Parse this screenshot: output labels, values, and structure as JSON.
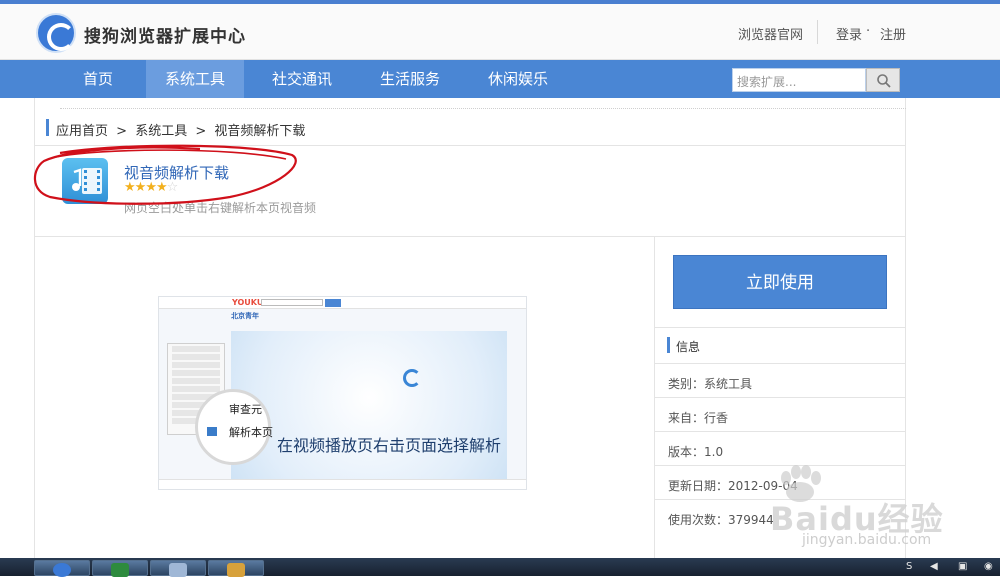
{
  "header": {
    "site_title": "搜狗浏览器扩展中心",
    "official_site": "浏览器官网",
    "login": "登录",
    "dot": "·",
    "register": "注册"
  },
  "nav": {
    "items": [
      "首页",
      "系统工具",
      "社交通讯",
      "生活服务",
      "休闲娱乐"
    ],
    "active": "系统工具",
    "search_placeholder": "搜索扩展..."
  },
  "breadcrumb": {
    "items": [
      "应用首页",
      "系统工具",
      "视音频解析下载"
    ],
    "separator": ">"
  },
  "app": {
    "name": "视音频解析下载",
    "rating": 4,
    "max_rating": 5,
    "description": "网页空白处单击右键解析本页视音频"
  },
  "preview": {
    "logo": "YOUKU",
    "title": "北京青年",
    "menu_item_1": "审查元",
    "menu_item_2": "解析本页",
    "caption": "在视频播放页右击页面选择解析"
  },
  "sidebar": {
    "use_button": "立即使用",
    "info_title": "信息",
    "info": [
      "类别：系统工具",
      "来自：行香",
      "版本：1.0",
      "更新日期：2012-09-04",
      "使用次数：379944"
    ]
  },
  "watermark": {
    "brand": "Baidu经验",
    "url": "jingyan.baidu.com"
  },
  "colors": {
    "accent": "#4a86d4",
    "nav_active": "#6b9ddf",
    "link": "#3067b7",
    "star": "#f2b01e",
    "annotation": "#d0101a"
  }
}
